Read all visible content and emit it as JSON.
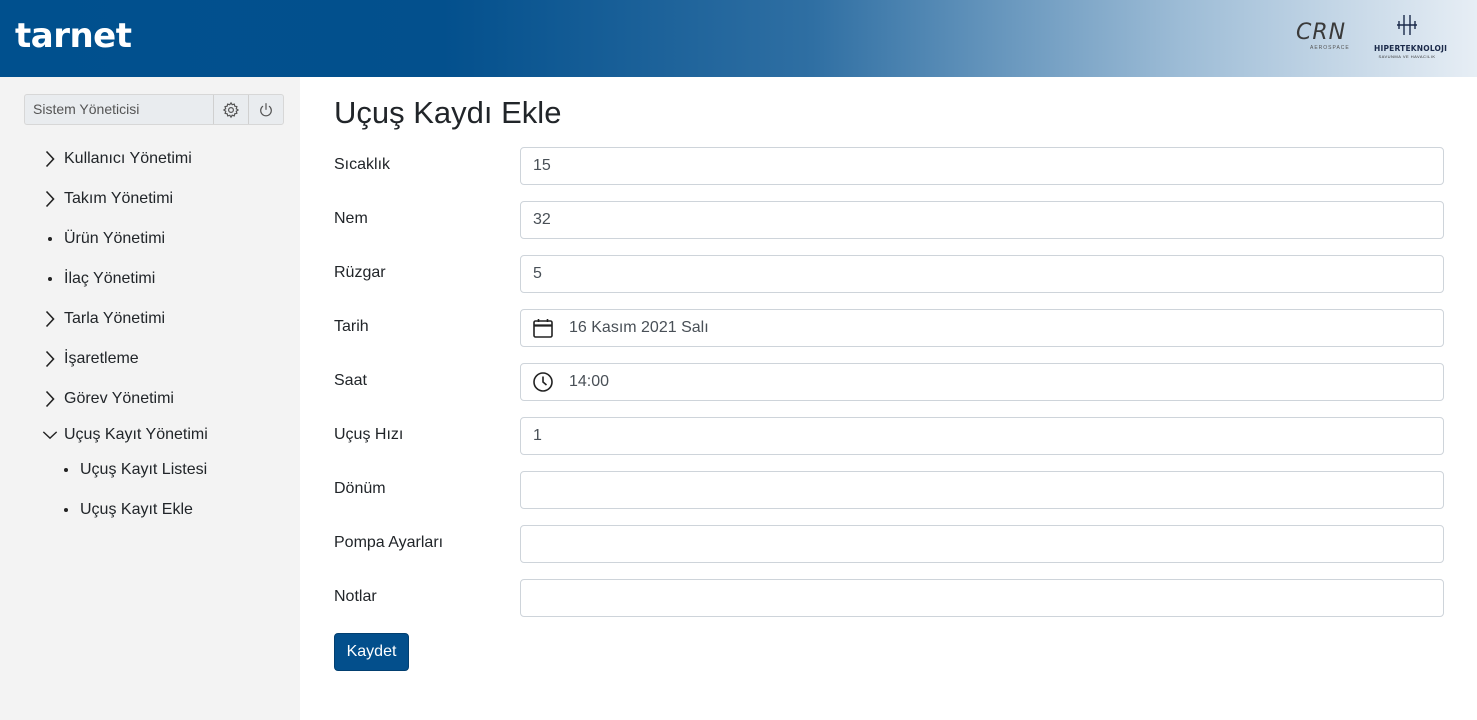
{
  "header": {
    "brand": "tarnet",
    "logo_crn": {
      "text": "CRN",
      "sub": "AEROSPACE"
    },
    "logo_hiper": {
      "name": "HIPERTEKNOLOJI",
      "sub": "SAVUNMA VE HAVACILIK"
    }
  },
  "sidebar": {
    "user_name": "Sistem Yöneticisi",
    "menu": [
      {
        "label": "Kullanıcı Yönetimi",
        "icon": "chevron-right-icon"
      },
      {
        "label": "Takım Yönetimi",
        "icon": "chevron-right-icon"
      },
      {
        "label": "Ürün Yönetimi",
        "icon": "bullet"
      },
      {
        "label": "İlaç Yönetimi",
        "icon": "bullet"
      },
      {
        "label": "Tarla Yönetimi",
        "icon": "chevron-right-icon"
      },
      {
        "label": "İşaretleme",
        "icon": "chevron-right-icon"
      },
      {
        "label": "Görev Yönetimi",
        "icon": "chevron-right-icon"
      },
      {
        "label": "Uçuş Kayıt Yönetimi",
        "icon": "chevron-down-icon"
      }
    ],
    "submenu": [
      {
        "label": "Uçuş Kayıt Listesi"
      },
      {
        "label": "Uçuş Kayıt Ekle"
      }
    ]
  },
  "main": {
    "title": "Uçuş Kaydı Ekle",
    "fields": [
      {
        "label": "Sıcaklık",
        "value": "15"
      },
      {
        "label": "Nem",
        "value": "32"
      },
      {
        "label": "Rüzgar",
        "value": "5"
      },
      {
        "label": "Tarih",
        "value": "16 Kasım 2021 Salı",
        "icon": "calendar-icon"
      },
      {
        "label": "Saat",
        "value": "14:00",
        "icon": "clock-icon"
      },
      {
        "label": "Uçuş Hızı",
        "value": "1"
      },
      {
        "label": "Dönüm",
        "value": ""
      },
      {
        "label": "Pompa Ayarları",
        "value": ""
      },
      {
        "label": "Notlar",
        "value": ""
      }
    ],
    "save_label": "Kaydet"
  },
  "colors": {
    "primary": "#034f8c",
    "sidebar_bg": "#f3f3f3"
  }
}
